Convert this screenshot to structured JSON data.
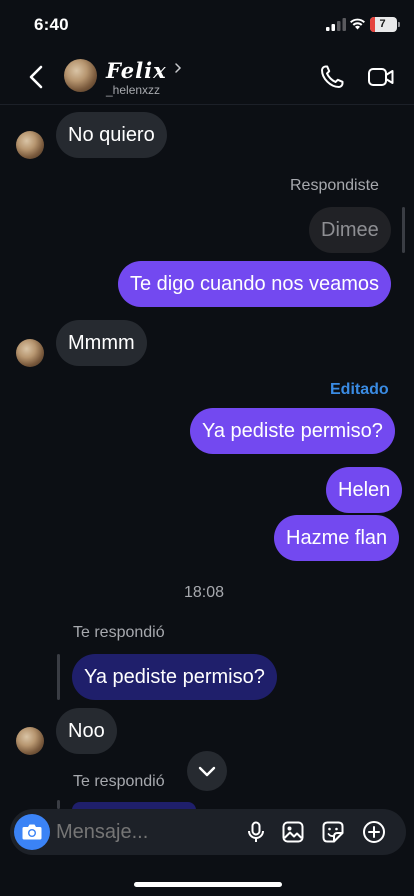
{
  "status_bar": {
    "time": "6:40",
    "battery_level": "7"
  },
  "header": {
    "name": "Felix",
    "username": "_helenxzz"
  },
  "messages": {
    "m1": "No quiero",
    "reply_label_1": "Respondiste",
    "reply_quote_1": "Dimee",
    "m2": "Te digo cuando nos veamos",
    "m3": "Mmmm",
    "edited_label": "Editado",
    "m4": "Ya pediste permiso?",
    "m5": "Helen",
    "m6": "Hazme flan",
    "timestamp": "18:08",
    "reply_label_2": "Te respondió",
    "reply_quote_2": "Ya pediste permiso?",
    "m7": "Noo",
    "reply_label_3": "Te respondió"
  },
  "composer": {
    "placeholder": "Mensaje..."
  },
  "colors": {
    "outgoing": "#7349f0",
    "incoming": "#262a30",
    "reply_quote": "#1f1f6b",
    "edited": "#3a8be3",
    "camera": "#3b83f6",
    "background": "#0c0f14"
  },
  "icons": [
    "back-icon",
    "chevron-right-icon",
    "phone-icon",
    "video-camera-icon",
    "chevron-down-icon",
    "camera-icon",
    "microphone-icon",
    "image-icon",
    "sticker-icon",
    "plus-circle-icon"
  ]
}
